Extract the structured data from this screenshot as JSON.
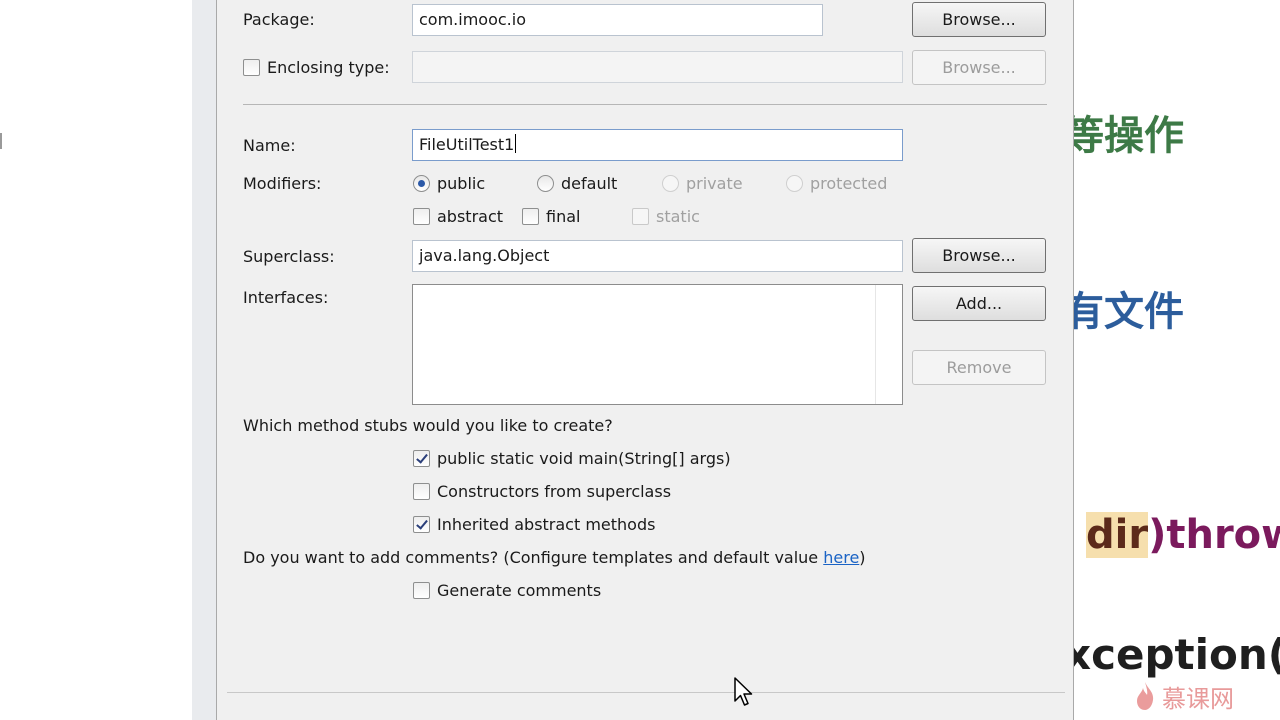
{
  "dialog": {
    "package": {
      "label": "Package:",
      "value": "com.imooc.io",
      "browse_label": "Browse..."
    },
    "enclosing_type": {
      "label": "Enclosing type:",
      "value": "",
      "browse_label": "Browse...",
      "checked": false
    },
    "name": {
      "label": "Name:",
      "value": "FileUtilTest1"
    },
    "modifiers": {
      "label": "Modifiers:",
      "access": [
        {
          "label": "public",
          "selected": true,
          "enabled": true
        },
        {
          "label": "default",
          "selected": false,
          "enabled": true
        },
        {
          "label": "private",
          "selected": false,
          "enabled": false
        },
        {
          "label": "protected",
          "selected": false,
          "enabled": false
        }
      ],
      "other": [
        {
          "label": "abstract",
          "checked": false,
          "enabled": true
        },
        {
          "label": "final",
          "checked": false,
          "enabled": true
        },
        {
          "label": "static",
          "checked": false,
          "enabled": false
        }
      ]
    },
    "superclass": {
      "label": "Superclass:",
      "value": "java.lang.Object",
      "browse_label": "Browse..."
    },
    "interfaces": {
      "label": "Interfaces:",
      "items": [],
      "add_label": "Add...",
      "remove_label": "Remove"
    },
    "method_stubs": {
      "question": "Which method stubs would you like to create?",
      "options": [
        {
          "label": "public static void main(String[] args)",
          "checked": true
        },
        {
          "label": "Constructors from superclass",
          "checked": false
        },
        {
          "label": "Inherited abstract methods",
          "checked": true
        }
      ]
    },
    "comments": {
      "question_prefix": "Do you want to add comments? (Configure templates and default value ",
      "link_text": "here",
      "question_suffix": ")",
      "generate_label": "Generate comments",
      "generate_checked": false
    }
  },
  "background": {
    "line1": "等操作",
    "line2": "有文件",
    "line3_highlight": "dir",
    "line3_rest": ")throw",
    "line4": "xception(\"",
    "watermark": "慕课网"
  }
}
